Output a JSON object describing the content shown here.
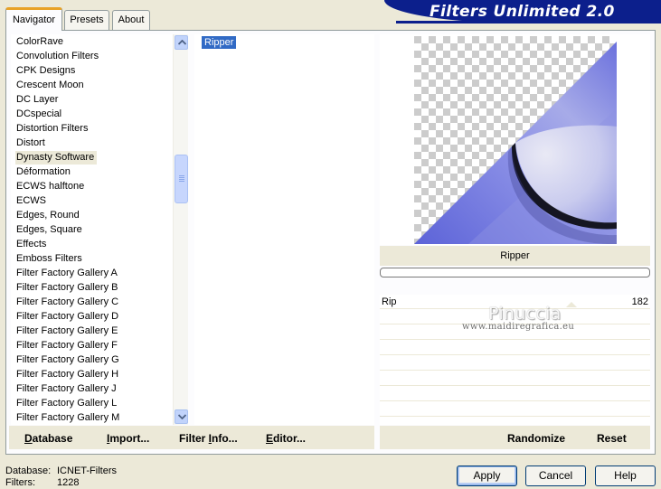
{
  "app": {
    "title": "Filters Unlimited 2.0"
  },
  "tabs": [
    {
      "label": "Navigator",
      "active": true
    },
    {
      "label": "Presets",
      "active": false
    },
    {
      "label": "About",
      "active": false
    }
  ],
  "categories": {
    "selected": "Dynasty Software",
    "items": [
      "ColorRave",
      "Convolution Filters",
      "CPK Designs",
      "Crescent Moon",
      "DC Layer",
      "DCspecial",
      "Distortion Filters",
      "Distort",
      "Dynasty Software",
      "Déformation",
      "ECWS halftone",
      "ECWS",
      "Edges, Round",
      "Edges, Square",
      "Effects",
      "Emboss Filters",
      "Filter Factory Gallery A",
      "Filter Factory Gallery B",
      "Filter Factory Gallery C",
      "Filter Factory Gallery D",
      "Filter Factory Gallery E",
      "Filter Factory Gallery F",
      "Filter Factory Gallery G",
      "Filter Factory Gallery H",
      "Filter Factory Gallery J",
      "Filter Factory Gallery L",
      "Filter Factory Gallery M"
    ]
  },
  "filters": {
    "items": [
      "Ripper"
    ],
    "selected": "Ripper"
  },
  "preview": {
    "filter_name": "Ripper",
    "colors": {
      "accent": "#6f74e0",
      "light": "#d7d8f1",
      "checker": "#cccccc"
    }
  },
  "controls": [
    {
      "label": "Rip",
      "value": "182"
    }
  ],
  "watermark": {
    "name": "Pinuccia",
    "url": "www.maidiregrafica.eu"
  },
  "toolbar": {
    "database": {
      "underline": "D",
      "rest": "atabase"
    },
    "import": {
      "underline": "I",
      "rest": "mport..."
    },
    "filter_info": {
      "pre": "Filter ",
      "underline": "I",
      "rest": "nfo..."
    },
    "editor": {
      "underline": "E",
      "rest": "ditor..."
    },
    "randomize": "Randomize",
    "reset": "Reset"
  },
  "status": {
    "database_label": "Database:",
    "database_value": "ICNET-Filters",
    "filters_label": "Filters:",
    "filters_value": "1228"
  },
  "buttons": {
    "apply": "Apply",
    "cancel": "Cancel",
    "help": "Help"
  }
}
